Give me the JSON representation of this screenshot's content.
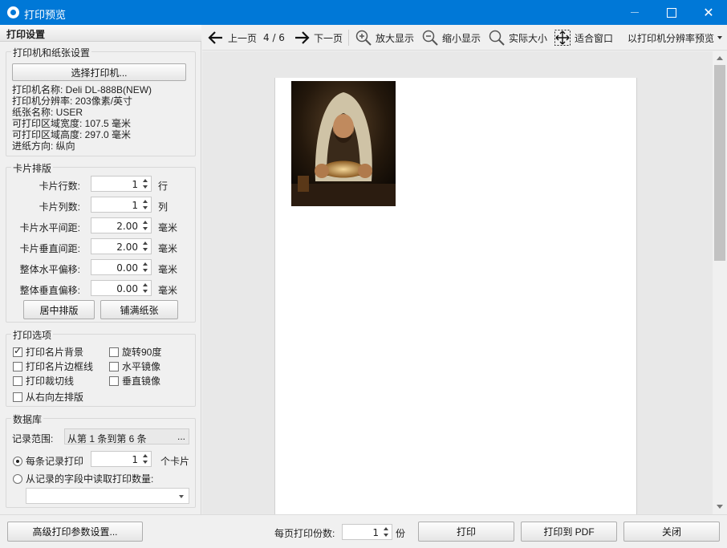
{
  "window": {
    "title": "打印预览"
  },
  "left": {
    "header": "打印设置",
    "printer": {
      "title": "打印机和纸张设置",
      "select_button": "选择打印机...",
      "lines": [
        "打印机名称: Deli DL-888B(NEW)",
        "打印机分辨率: 203像素/英寸",
        "纸张名称: USER",
        "可打印区域宽度: 107.5 毫米",
        "可打印区域高度: 297.0 毫米",
        "进纸方向: 纵向"
      ]
    },
    "layout": {
      "title": "卡片排版",
      "rows": [
        {
          "label": "卡片行数:",
          "value": "1",
          "unit": "行"
        },
        {
          "label": "卡片列数:",
          "value": "1",
          "unit": "列"
        },
        {
          "label": "卡片水平间距:",
          "value": "2.00",
          "unit": "毫米"
        },
        {
          "label": "卡片垂直间距:",
          "value": "2.00",
          "unit": "毫米"
        },
        {
          "label": "整体水平偏移:",
          "value": "0.00",
          "unit": "毫米"
        },
        {
          "label": "整体垂直偏移:",
          "value": "0.00",
          "unit": "毫米"
        }
      ],
      "center_button": "居中排版",
      "fill_button": "铺满纸张"
    },
    "options": {
      "title": "打印选项",
      "print_background": "打印名片背景",
      "print_border": "打印名片边框线",
      "print_cutline": "打印裁切线",
      "right_to_left": "从右向左排版",
      "rotate90": "旋转90度",
      "mirror_h": "水平镜像",
      "mirror_v": "垂直镜像"
    },
    "database": {
      "title": "数据库",
      "range_label": "记录范围:",
      "range_value": "从第 1 条到第 6 条",
      "range_more": "...",
      "per_record_label": "每条记录打印",
      "per_record_value": "1",
      "per_record_unit": "个卡片",
      "from_field_label": "从记录的字段中读取打印数量:",
      "field_select_value": ""
    }
  },
  "toolbar": {
    "prev": "上一页",
    "page_info": "4 / 6",
    "next": "下一页",
    "zoom_in": "放大显示",
    "zoom_out": "缩小显示",
    "actual_size": "实际大小",
    "fit_window": "适合窗口",
    "resolution_preview": "以打印机分辨率预览"
  },
  "bottom": {
    "advanced_button": "高级打印参数设置...",
    "copies_label": "每页打印份数:",
    "copies_value": "1",
    "copies_unit": "份",
    "print_button": "打印",
    "pdf_button": "打印到 PDF",
    "close_button": "关闭"
  },
  "colors": {
    "titlebar": "#0078d7",
    "preview_bg": "#e8e8e8"
  }
}
